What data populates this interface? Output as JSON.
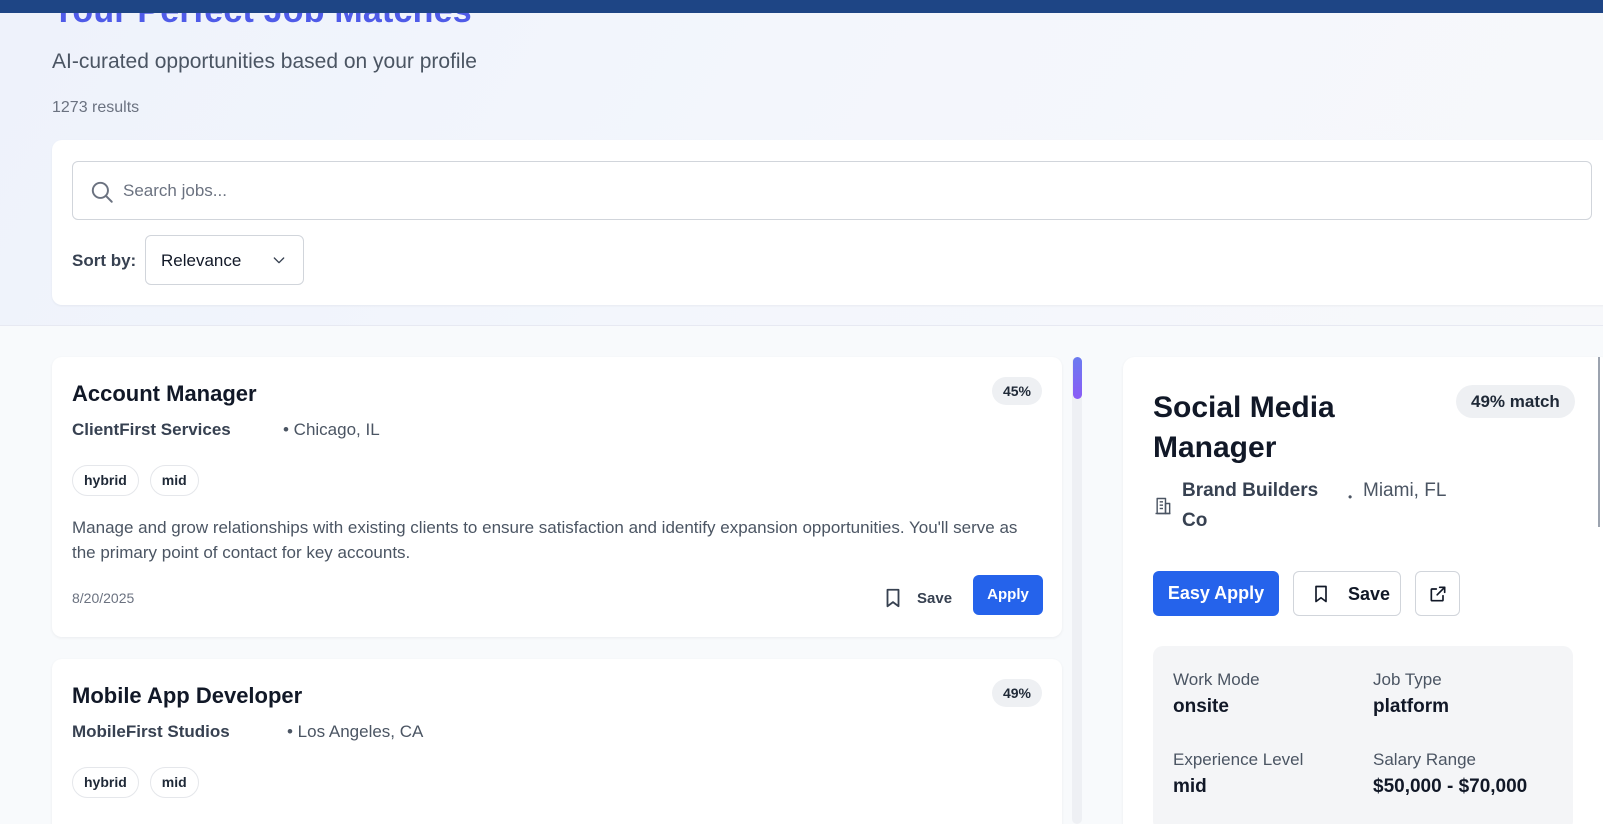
{
  "hero": {
    "title": "Your Perfect Job Matches",
    "subtitle": "AI-curated opportunities based on your profile",
    "result_count": "1273 results"
  },
  "filters": {
    "search": {
      "placeholder": "Search jobs...",
      "value": ""
    },
    "sort_label": "Sort by:",
    "sort_value": "Relevance"
  },
  "jobs": [
    {
      "title": "Account Manager",
      "company": "ClientFirst Services",
      "location": "• Chicago, IL",
      "score": "45%",
      "tags": [
        "hybrid",
        "mid"
      ],
      "description": "Manage and grow relationships with existing clients to ensure satisfaction and identify expansion opportunities. You'll serve as the primary point of contact for key accounts.",
      "posted": "8/20/2025",
      "save_label": "Save",
      "apply_label": "Apply"
    },
    {
      "title": "Mobile App Developer",
      "company": "MobileFirst Studios",
      "location": "• Los Angeles, CA",
      "score": "49%",
      "tags": [
        "hybrid",
        "mid"
      ]
    }
  ],
  "detail": {
    "title": "Social Media Manager",
    "match": "49% match",
    "company": "Brand Builders Co",
    "separator": "•",
    "location": "Miami, FL",
    "easy_apply_label": "Easy Apply",
    "save_label": "Save",
    "info": {
      "work_mode": {
        "label": "Work Mode",
        "value": "onsite"
      },
      "job_type": {
        "label": "Job Type",
        "value": "platform"
      },
      "experience": {
        "label": "Experience Level",
        "value": "mid"
      },
      "salary": {
        "label": "Salary Range",
        "value": "$50,000 - $70,000"
      }
    }
  },
  "icons": {
    "search": "search-icon",
    "sort_toggle": "chevron-down-icon",
    "save": "bookmark-icon",
    "company": "building-icon",
    "external": "external-link-icon"
  },
  "colors": {
    "top_bar": "#1e4585",
    "title_accent": "#4f5be8",
    "primary": "#2563eb",
    "scroll_thumb": "#7c6cf3"
  }
}
